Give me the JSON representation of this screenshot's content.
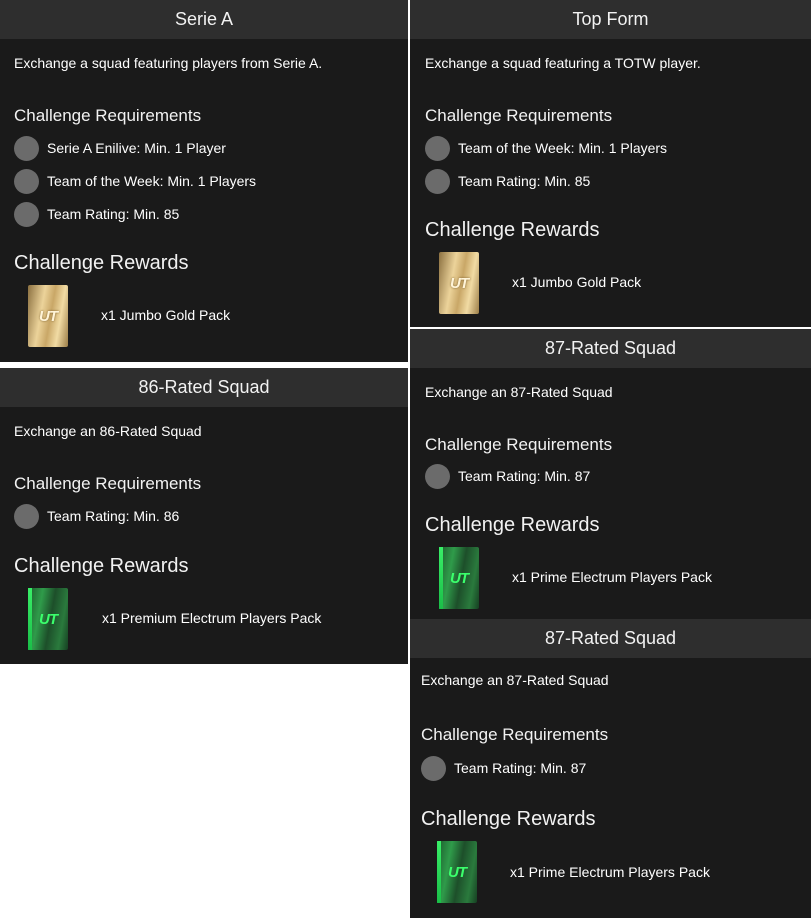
{
  "cards": [
    {
      "title": "Serie A",
      "description": "Exchange a squad featuring players from Serie A.",
      "requirements_heading": "Challenge Requirements",
      "requirements": [
        "Serie A Enilive: Min. 1 Player",
        "Team of the Week: Min. 1 Players",
        "Team Rating: Min. 85"
      ],
      "rewards_heading": "Challenge Rewards",
      "reward": "x1 Jumbo Gold Pack",
      "pack_type": "gold",
      "pack_logo": "UT"
    },
    {
      "title": "Top Form",
      "description": "Exchange a squad featuring a TOTW player.",
      "requirements_heading": "Challenge Requirements",
      "requirements": [
        "Team of the Week: Min. 1 Players",
        "Team Rating: Min. 85"
      ],
      "rewards_heading": "Challenge Rewards",
      "reward": "x1 Jumbo Gold Pack",
      "pack_type": "gold",
      "pack_logo": "UT"
    },
    {
      "title": "86-Rated Squad",
      "description": "Exchange an 86-Rated Squad",
      "requirements_heading": "Challenge Requirements",
      "requirements": [
        "Team Rating: Min. 86"
      ],
      "rewards_heading": "Challenge Rewards",
      "reward": "x1 Premium Electrum Players Pack",
      "pack_type": "electrum",
      "pack_logo": "UT"
    },
    {
      "title": "87-Rated Squad",
      "description": "Exchange an 87-Rated Squad",
      "requirements_heading": "Challenge Requirements",
      "requirements": [
        "Team Rating: Min. 87"
      ],
      "rewards_heading": "Challenge Rewards",
      "reward": "x1 Prime Electrum Players Pack",
      "pack_type": "electrum",
      "pack_logo": "UT"
    },
    {
      "title": "87-Rated Squad",
      "description": "Exchange an 87-Rated Squad",
      "requirements_heading": "Challenge Requirements",
      "requirements": [
        "Team Rating: Min. 87"
      ],
      "rewards_heading": "Challenge Rewards",
      "reward": "x1 Prime Electrum Players Pack",
      "pack_type": "electrum",
      "pack_logo": "UT"
    }
  ],
  "colors": {
    "panel_bg": "#1a1a1a",
    "header_bg": "#2e2e2e",
    "status_dot": "#6b6b6b",
    "gold_pack": "#d9bd7f",
    "electrum_pack": "#2f9b4a"
  },
  "icons": {
    "requirement_status": "circle-status-icon",
    "gold_pack": "jumbo-gold-pack-icon",
    "electrum_pack": "electrum-pack-icon"
  }
}
